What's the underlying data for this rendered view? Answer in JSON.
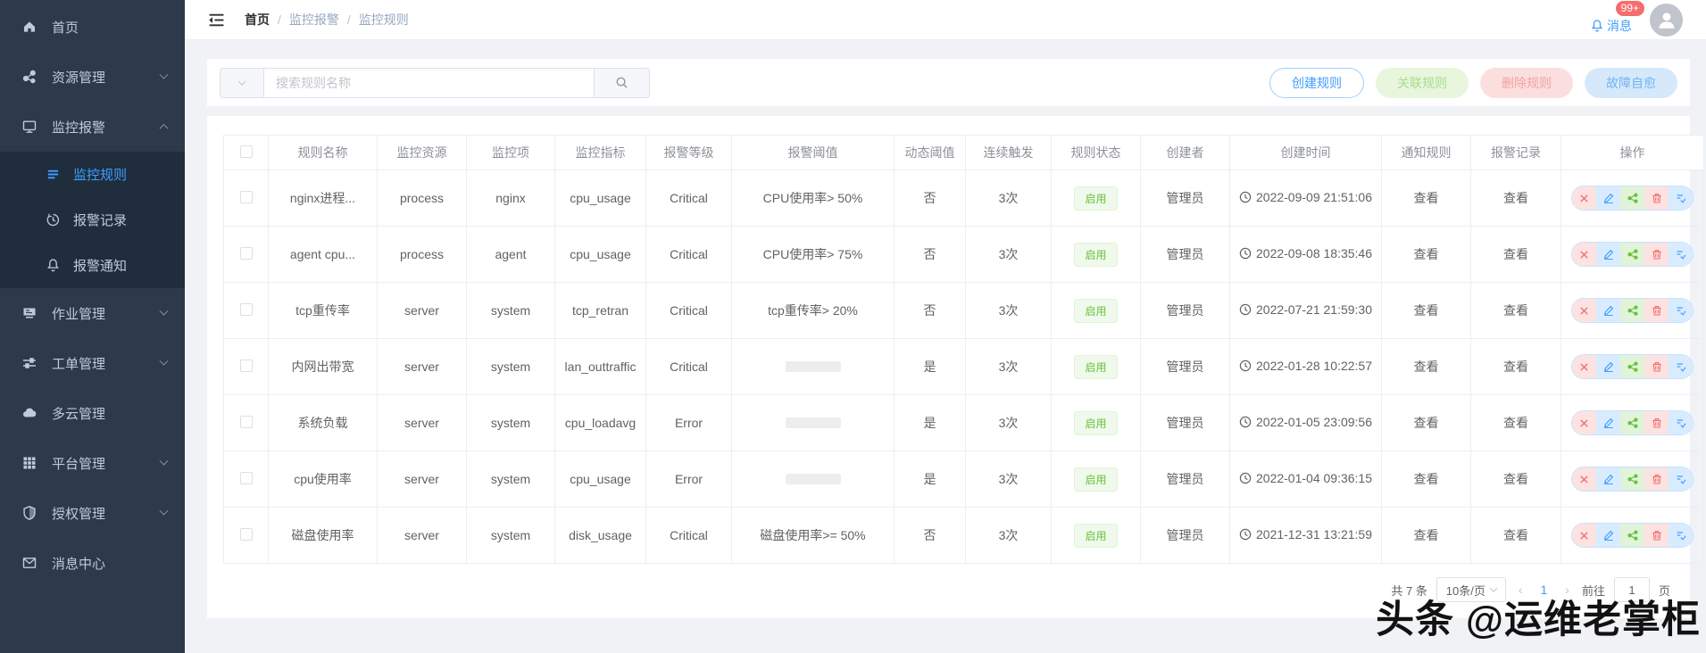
{
  "sidebar": {
    "home": "首页",
    "resources": "资源管理",
    "monitoring": "监控报警",
    "monitor_rules": "监控规则",
    "alert_records": "报警记录",
    "alert_notify": "报警通知",
    "jobs": "作业管理",
    "tickets": "工单管理",
    "multicloud": "多云管理",
    "platform": "平台管理",
    "auth": "授权管理",
    "messages": "消息中心"
  },
  "header": {
    "breadcrumb": [
      "首页",
      "监控报警",
      "监控规则"
    ],
    "separator": "/",
    "badge": "99+",
    "messages_label": "消息"
  },
  "toolbar": {
    "search_placeholder": "搜索规则名称",
    "create": "创建规则",
    "link": "关联规则",
    "delete": "删除规则",
    "self_heal": "故障自愈"
  },
  "table": {
    "headers": [
      "规则名称",
      "监控资源",
      "监控项",
      "监控指标",
      "报警等级",
      "报警阈值",
      "动态阈值",
      "连续触发",
      "规则状态",
      "创建者",
      "创建时间",
      "通知规则",
      "报警记录",
      "操作"
    ],
    "rows": [
      {
        "rule_name": "nginx进程...",
        "resource": "process",
        "item": "nginx",
        "metric": "cpu_usage",
        "level": "Critical",
        "threshold": "CPU使用率> 50%",
        "dynamic": "否",
        "trigger": "3次",
        "status": "启用",
        "creator": "管理员",
        "created": "2022-09-09 21:51:06",
        "notify": "查看",
        "record": "查看"
      },
      {
        "rule_name": "agent cpu...",
        "resource": "process",
        "item": "agent",
        "metric": "cpu_usage",
        "level": "Critical",
        "threshold": "CPU使用率> 75%",
        "dynamic": "否",
        "trigger": "3次",
        "status": "启用",
        "creator": "管理员",
        "created": "2022-09-08 18:35:46",
        "notify": "查看",
        "record": "查看"
      },
      {
        "rule_name": "tcp重传率",
        "resource": "server",
        "item": "system",
        "metric": "tcp_retran",
        "level": "Critical",
        "threshold": "tcp重传率> 20%",
        "dynamic": "否",
        "trigger": "3次",
        "status": "启用",
        "creator": "管理员",
        "created": "2022-07-21 21:59:30",
        "notify": "查看",
        "record": "查看"
      },
      {
        "rule_name": "内网出带宽",
        "resource": "server",
        "item": "system",
        "metric": "lan_outtraffic",
        "level": "Critical",
        "threshold": "",
        "dynamic": "是",
        "trigger": "3次",
        "status": "启用",
        "creator": "管理员",
        "created": "2022-01-28 10:22:57",
        "notify": "查看",
        "record": "查看"
      },
      {
        "rule_name": "系统负载",
        "resource": "server",
        "item": "system",
        "metric": "cpu_loadavg",
        "level": "Error",
        "threshold": "",
        "dynamic": "是",
        "trigger": "3次",
        "status": "启用",
        "creator": "管理员",
        "created": "2022-01-05 23:09:56",
        "notify": "查看",
        "record": "查看"
      },
      {
        "rule_name": "cpu使用率",
        "resource": "server",
        "item": "system",
        "metric": "cpu_usage",
        "level": "Error",
        "threshold": "",
        "dynamic": "是",
        "trigger": "3次",
        "status": "启用",
        "creator": "管理员",
        "created": "2022-01-04 09:36:15",
        "notify": "查看",
        "record": "查看"
      },
      {
        "rule_name": "磁盘使用率",
        "resource": "server",
        "item": "system",
        "metric": "disk_usage",
        "level": "Critical",
        "threshold": "磁盘使用率>= 50%",
        "dynamic": "否",
        "trigger": "3次",
        "status": "启用",
        "creator": "管理员",
        "created": "2021-12-31 13:21:59",
        "notify": "查看",
        "record": "查看"
      }
    ]
  },
  "pagination": {
    "total": "共 7 条",
    "page_size": "10条/页",
    "current": "1",
    "goto_label": "前往",
    "goto_value": "1",
    "page_label": "页"
  },
  "watermark": "头条 @运维老掌柜",
  "colors": {
    "accent": "#409eff",
    "danger": "#f56c6c",
    "success": "#67c23a",
    "sidebar_bg": "#2d3a4b",
    "submenu_bg": "#1f2d3d"
  }
}
